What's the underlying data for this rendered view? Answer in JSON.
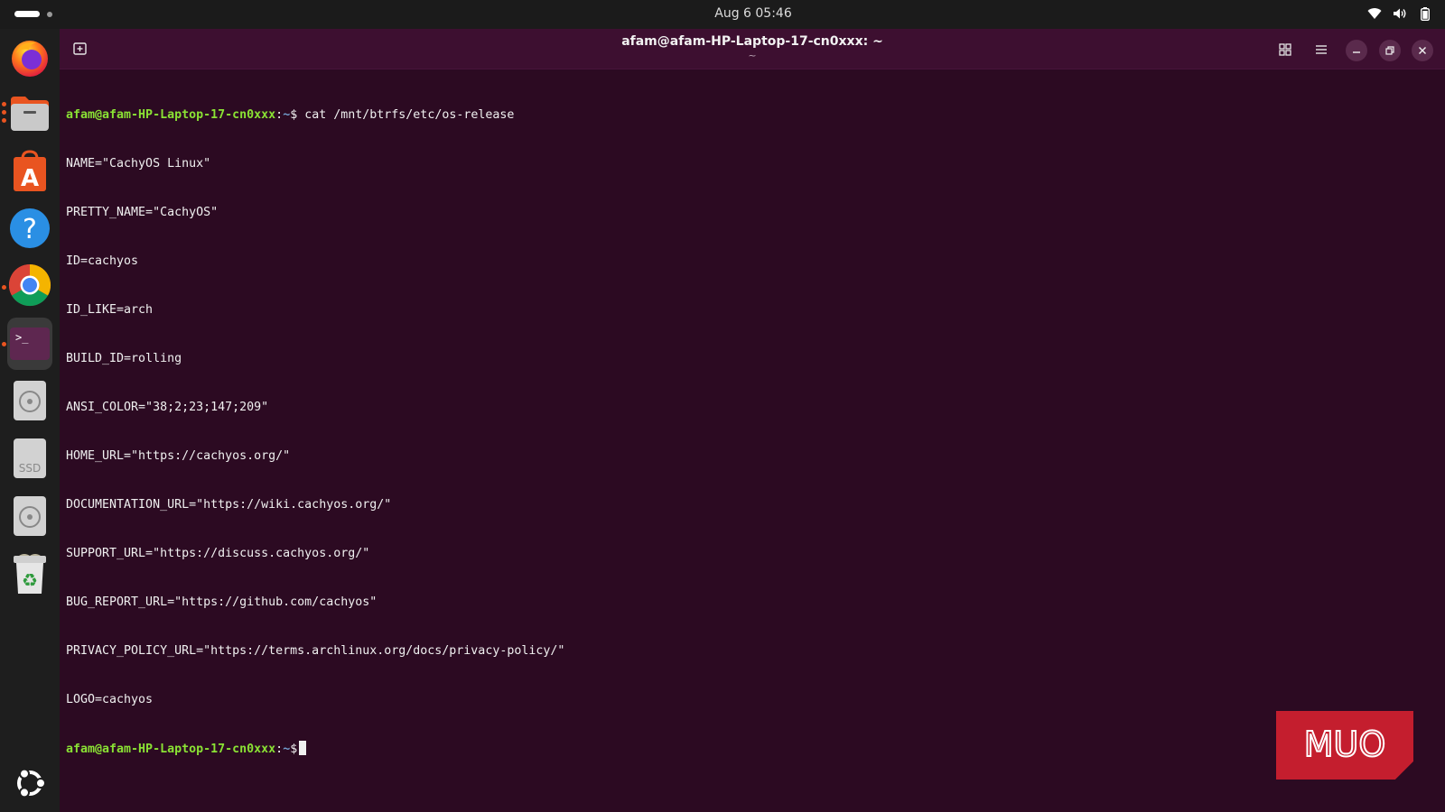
{
  "topbar": {
    "datetime": "Aug 6  05:46",
    "icons": [
      "wifi-icon",
      "volume-icon",
      "battery-icon"
    ]
  },
  "dock": {
    "apps": [
      {
        "name": "firefox",
        "running": false
      },
      {
        "name": "files",
        "running": true
      },
      {
        "name": "app-center",
        "running": false
      },
      {
        "name": "help",
        "running": false
      },
      {
        "name": "chrome",
        "running": true
      },
      {
        "name": "terminal",
        "running": true,
        "active": true
      },
      {
        "name": "disk-drive",
        "running": false
      },
      {
        "name": "ssd-drive",
        "label": "SSD",
        "running": false
      },
      {
        "name": "disk-drive-2",
        "running": false
      },
      {
        "name": "trash",
        "running": false
      },
      {
        "name": "show-apps",
        "running": false
      }
    ]
  },
  "window": {
    "title": "afam@afam-HP-Laptop-17-cn0xxx: ~",
    "subtitle": "~"
  },
  "terminal": {
    "prompt_user": "afam@afam-HP-Laptop-17-cn0xxx",
    "prompt_sep": ":",
    "prompt_path": "~",
    "prompt_symbol": "$",
    "command": " cat /mnt/btrfs/etc/os-release",
    "output": [
      "NAME=\"CachyOS Linux\"",
      "PRETTY_NAME=\"CachyOS\"",
      "ID=cachyos",
      "ID_LIKE=arch",
      "BUILD_ID=rolling",
      "ANSI_COLOR=\"38;2;23;147;209\"",
      "HOME_URL=\"https://cachyos.org/\"",
      "DOCUMENTATION_URL=\"https://wiki.cachyos.org/\"",
      "SUPPORT_URL=\"https://discuss.cachyos.org/\"",
      "BUG_REPORT_URL=\"https://github.com/cachyos\"",
      "PRIVACY_POLICY_URL=\"https://terms.archlinux.org/docs/privacy-policy/\"",
      "LOGO=cachyos"
    ]
  },
  "watermark": {
    "text": "MUO"
  },
  "colors": {
    "terminal_bg": "#2c0a22",
    "header_bg": "#3d0f30",
    "prompt_user": "#8ae234",
    "prompt_path": "#729fcf",
    "watermark": "#c41e2e"
  }
}
